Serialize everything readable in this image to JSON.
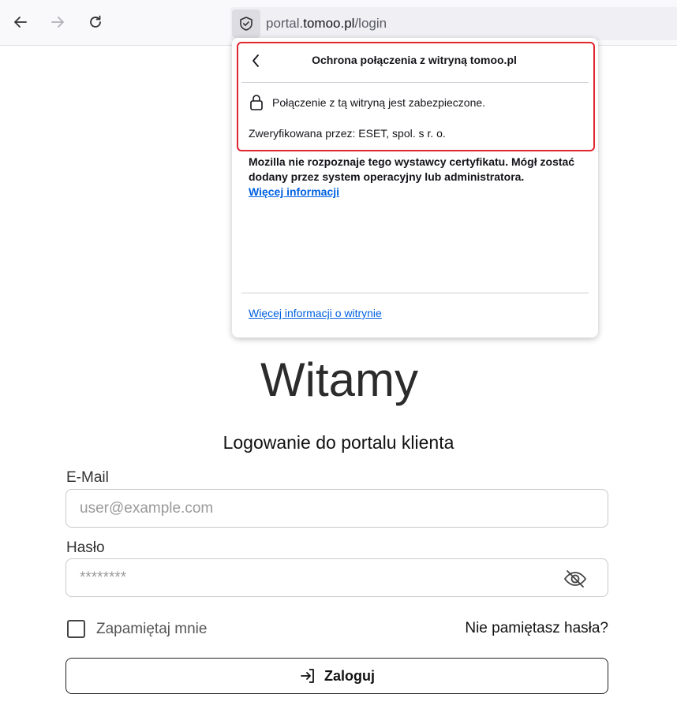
{
  "browser": {
    "url_prefix": "portal.",
    "url_host": "tomoo.pl",
    "url_path": "/login",
    "icons": {
      "back": "arrow-left-icon",
      "forward": "arrow-right-icon",
      "reload": "reload-icon",
      "site_identity": "shield-icon"
    }
  },
  "security_panel": {
    "title": "Ochrona połączenia z witryną tomoo.pl",
    "secure_message": "Połączenie z tą witryną jest zabezpieczone.",
    "verified_by": "Zweryfikowana przez: ESET, spol. s r. o.",
    "warning": "Mozilla nie rozpoznaje tego wystawcy certyfikatu. Mógł zostać dodany przez system operacyjny lub administratora.",
    "more_info_link": "Więcej informacji",
    "site_info_link": "Więcej informacji o witrynie",
    "highlight_color": "#e0262f",
    "link_color": "#0061e0"
  },
  "page": {
    "welcome": "Witamy",
    "subtitle": "Logowanie do portalu klienta",
    "email_label": "E-Mail",
    "email_placeholder": "user@example.com",
    "password_label": "Hasło",
    "password_placeholder": "********",
    "remember_me": "Zapamiętaj mnie",
    "forgot_password": "Nie pamiętasz hasła?",
    "login_button": "Zaloguj"
  }
}
